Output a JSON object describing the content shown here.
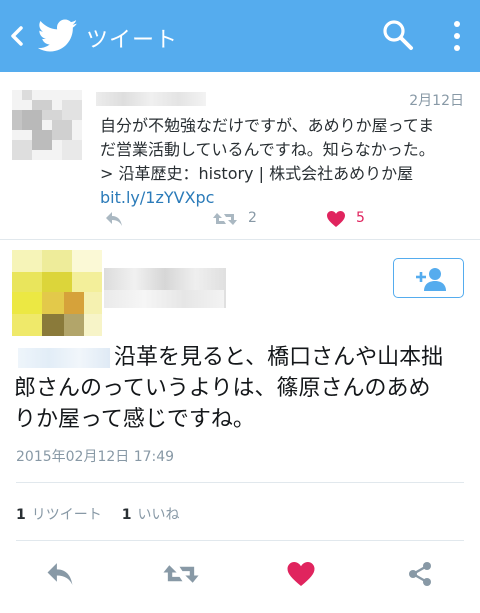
{
  "header": {
    "title": "ツイート",
    "bg_color": "#55acee"
  },
  "quoted_tweet": {
    "date": "2月12日",
    "text_line1": "自分が不勉強なだけですが、あめりか屋ってま",
    "text_line2": "だ営業活動しているんですね。知らなかった。",
    "text_line3": "> 沿革歴史：history | 株式会社あめりか屋",
    "link": "bit.ly/1zYVXpc",
    "retweet_count": "2",
    "like_count": "5"
  },
  "main_tweet": {
    "text_line1": "沿革を見ると、橋口さんや山本拙",
    "text_line2": "郎さんのっていうよりは、篠原さんのあめ",
    "text_line3": "りか屋って感じですね。",
    "timestamp": "2015年02月12日 17:49",
    "retweet_count": "1",
    "retweet_label": "リツイート",
    "like_count": "1",
    "like_label": "いいね"
  },
  "icons": {
    "back": "chevron-left-icon",
    "logo": "twitter-bird-icon",
    "search": "search-icon",
    "more": "more-vertical-icon",
    "reply": "reply-icon",
    "retweet": "retweet-icon",
    "like": "heart-icon",
    "share": "share-icon",
    "follow": "add-user-icon"
  },
  "colors": {
    "accent": "#55acee",
    "like": "#e0245e",
    "link": "#2b7bb9",
    "muted": "#8899a6"
  }
}
